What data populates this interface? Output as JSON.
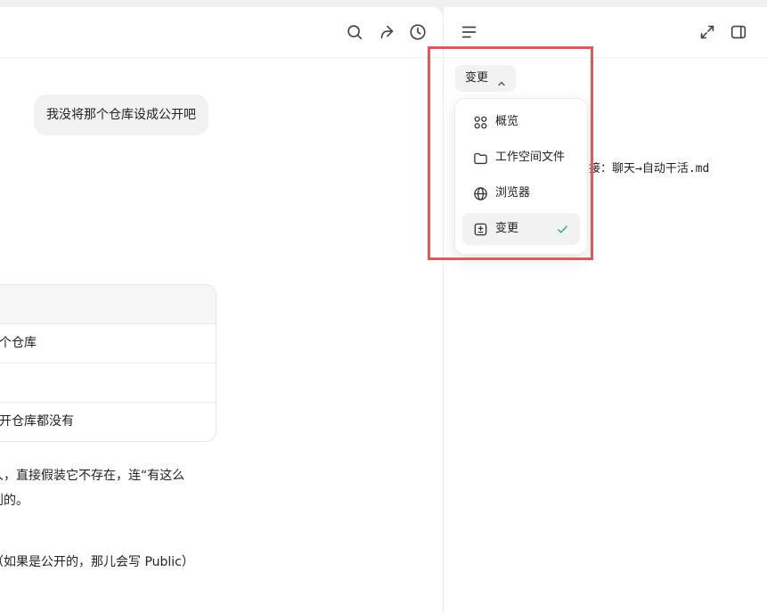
{
  "chat": {
    "user_message": "我没将那个仓库设成公开吧",
    "table": {
      "rows": [
        "这个仓库",
        "",
        "公开仓库都没有"
      ]
    },
    "para_line1": "人，直接假装它不存在，连“有这么",
    "para_line2": "到的。",
    "para_line3": "（如果是公开的，那儿会写 Public）"
  },
  "right_panel": {
    "selector_label": "变更",
    "file_path": "接：聊天→自动干活.md",
    "dropdown": {
      "items": [
        {
          "label": "概览",
          "icon": "grid-icon"
        },
        {
          "label": "工作空间文件",
          "icon": "folder-icon"
        },
        {
          "label": "浏览器",
          "icon": "globe-icon"
        },
        {
          "label": "变更",
          "icon": "diff-icon",
          "selected": true
        }
      ]
    }
  },
  "colors": {
    "highlight_border": "#e05a5a",
    "check_accent": "#2bb673",
    "bubble_bg": "#f2f2f2"
  }
}
